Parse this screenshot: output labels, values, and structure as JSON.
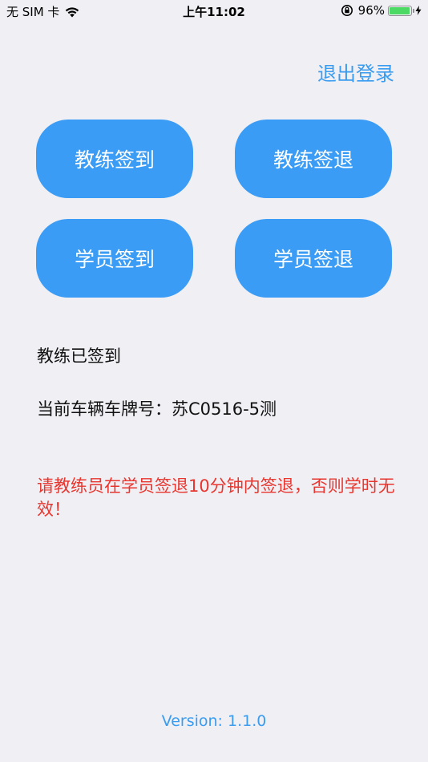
{
  "status_bar": {
    "carrier": "无 SIM 卡",
    "time": "上午11:02",
    "battery_percent_text": "96%",
    "battery_level": 0.96,
    "battery_color": "#4cd964",
    "icons": [
      "wifi-icon",
      "orientation-lock-icon",
      "battery-icon",
      "charging-bolt-icon"
    ]
  },
  "header": {
    "logout_label": "退出登录"
  },
  "actions": {
    "coach_sign_in": "教练签到",
    "coach_sign_out": "教练签退",
    "student_sign_in": "学员签到",
    "student_sign_out": "学员签退"
  },
  "info": {
    "status": "教练已签到",
    "plate": "当前车辆车牌号：苏C0516-5测"
  },
  "warning": "请教练员在学员签退10分钟内签退，否则学时无效！",
  "footer": {
    "version": "Version: 1.1.0"
  },
  "colors": {
    "accent": "#3a9cf5",
    "warning": "#e8362f",
    "background": "#efeff4"
  }
}
